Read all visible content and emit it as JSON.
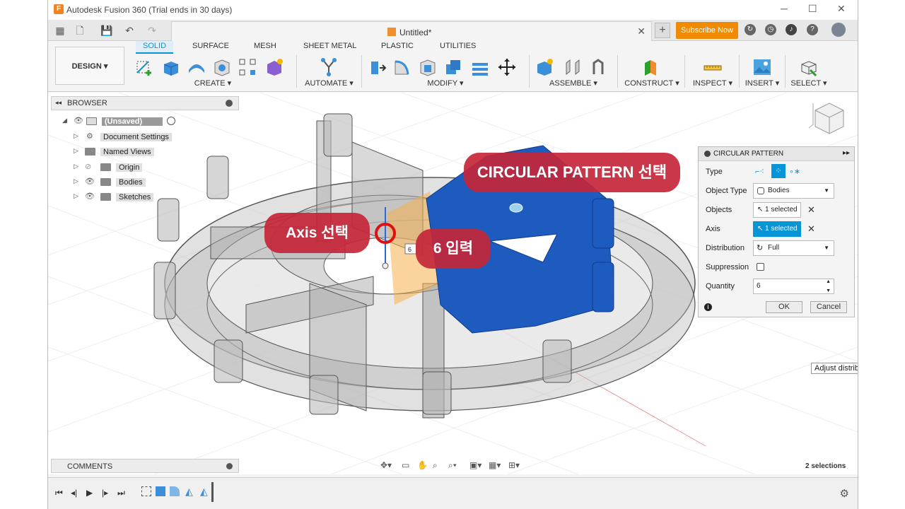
{
  "window": {
    "title": "Autodesk Fusion 360 (Trial ends in 30 days)"
  },
  "tabbar": {
    "doc_name": "Untitled*",
    "subscribe": "Subscribe Now"
  },
  "toolbar": {
    "workspace": "DESIGN ▾",
    "tabs": [
      "SOLID",
      "SURFACE",
      "MESH",
      "SHEET METAL",
      "PLASTIC",
      "UTILITIES"
    ],
    "active_tab": "SOLID",
    "groups": [
      "CREATE ▾",
      "AUTOMATE ▾",
      "MODIFY ▾",
      "ASSEMBLE ▾",
      "CONSTRUCT ▾",
      "INSPECT ▾",
      "INSERT ▾",
      "SELECT ▾"
    ]
  },
  "browser": {
    "title": "BROWSER",
    "root": "(Unsaved)",
    "items": [
      "Document Settings",
      "Named Views",
      "Origin",
      "Bodies",
      "Sketches"
    ]
  },
  "dialog": {
    "title": "CIRCULAR PATTERN",
    "type_label": "Type",
    "object_type_label": "Object Type",
    "object_type_value": "Bodies",
    "objects_label": "Objects",
    "objects_value": "1 selected",
    "axis_label": "Axis",
    "axis_value": "1 selected",
    "distribution_label": "Distribution",
    "distribution_value": "Full",
    "suppression_label": "Suppression",
    "quantity_label": "Quantity",
    "quantity_value": "6",
    "ok": "OK",
    "cancel": "Cancel"
  },
  "callouts": {
    "pattern": "CIRCULAR PATTERN 선택",
    "axis": "Axis 선택",
    "input": "6 입력",
    "viewport_value": "6"
  },
  "comments": {
    "title": "COMMENTS"
  },
  "status": {
    "selections": "2 selections",
    "tooltip": "Adjust distrib"
  },
  "colors": {
    "accent": "#0696d7",
    "subscribe": "#f08a00",
    "callout": "#c4263a",
    "body_blue": "#1e5bbf"
  }
}
